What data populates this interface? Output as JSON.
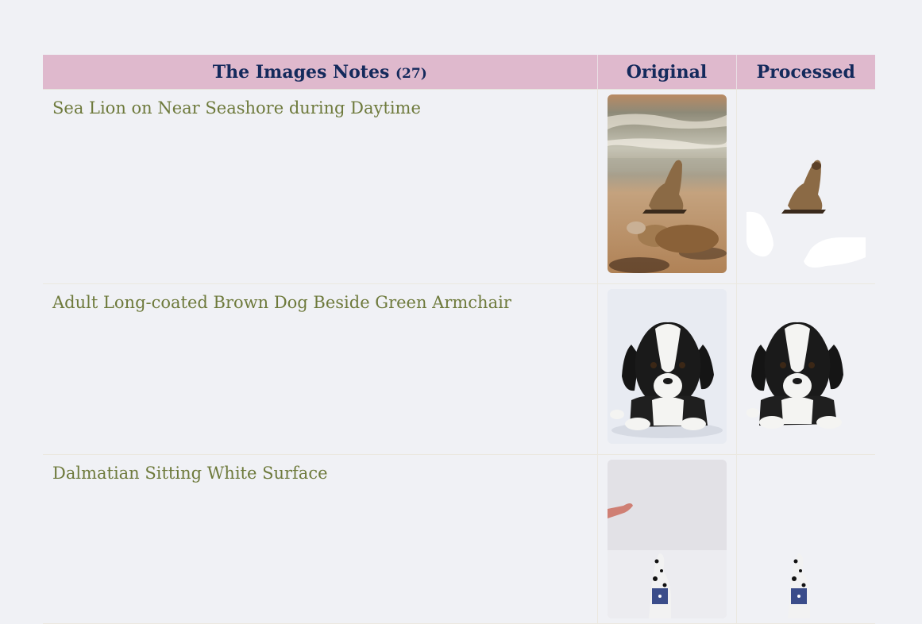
{
  "table": {
    "headers": {
      "notes_label": "The Images Notes",
      "notes_count": "(27)",
      "original": "Original",
      "processed": "Processed"
    },
    "rows": [
      {
        "title": "Sea Lion on Near Seashore during Daytime",
        "original_icon": "sea-lion-photo",
        "processed_icon": "sea-lion-cutout"
      },
      {
        "title": "Adult Long-coated Brown Dog Beside Green Armchair",
        "original_icon": "puppy-photo",
        "processed_icon": "puppy-cutout"
      },
      {
        "title": "Dalmatian Sitting White Surface",
        "original_icon": "dalmatian-photo",
        "processed_icon": "dalmatian-cutout"
      }
    ]
  },
  "colors": {
    "header_bg": "#dfb9cd",
    "header_text": "#142a5c",
    "title_text": "#6e7a3c",
    "page_bg": "#f0f1f5"
  }
}
